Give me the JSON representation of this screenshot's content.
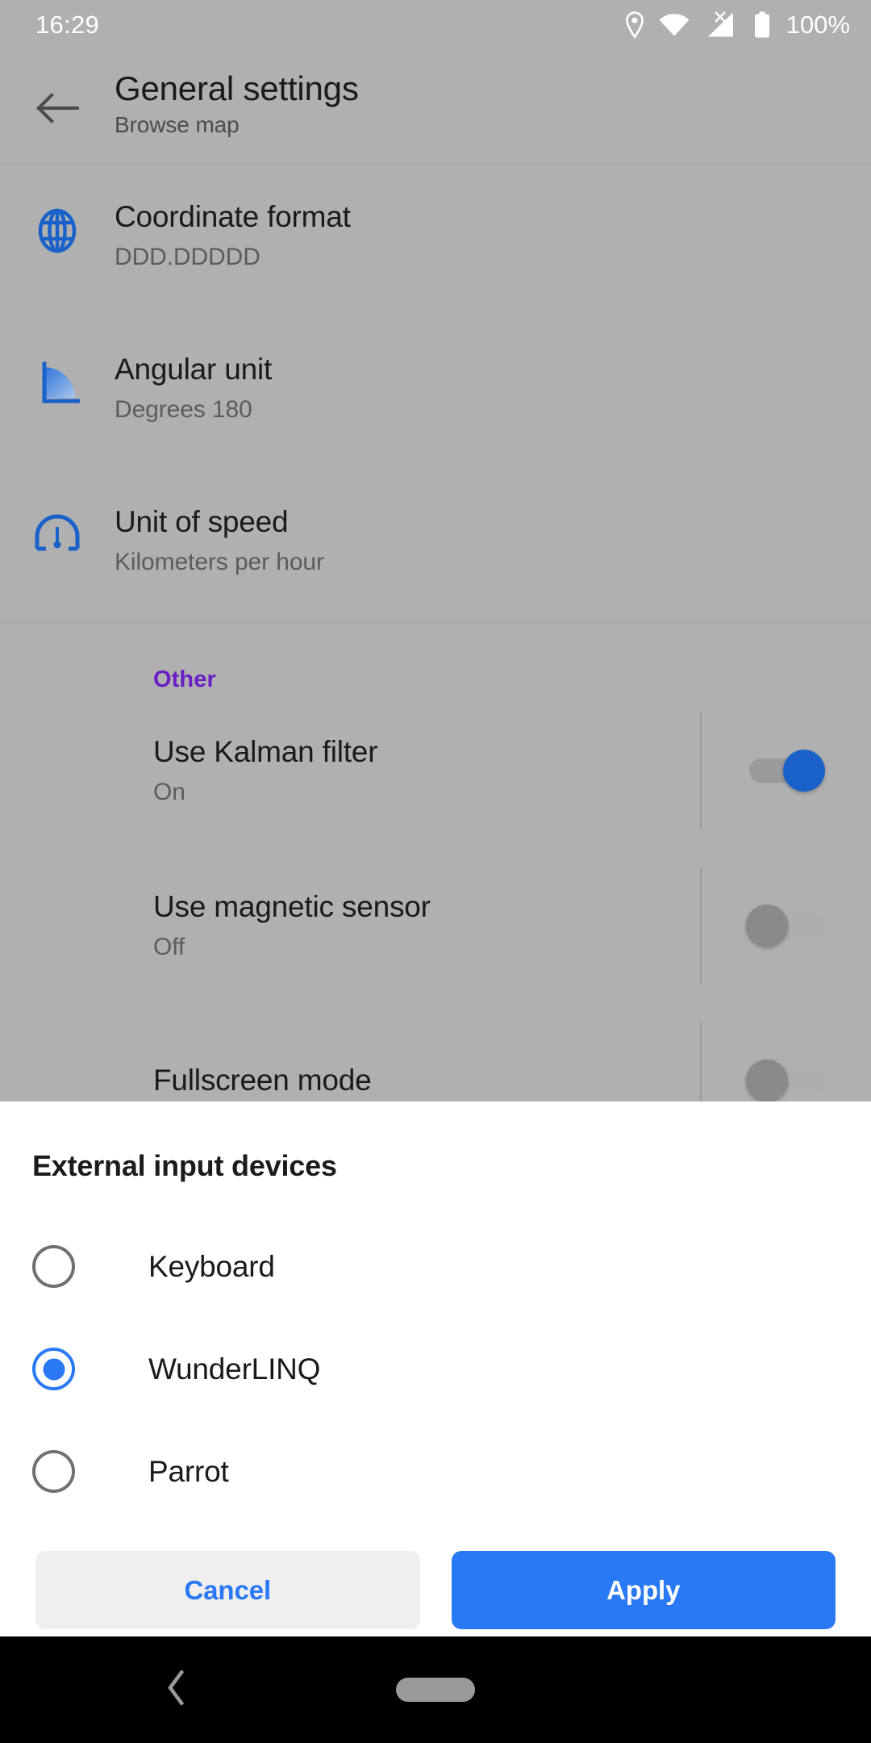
{
  "status_bar": {
    "clock": "16:29",
    "battery_percent": "100%",
    "icons": [
      "location-pin-icon",
      "wifi-icon",
      "cellular-signal-no-service-icon",
      "battery-full-icon"
    ]
  },
  "app_bar": {
    "back_icon": "arrow-back-icon",
    "title": "General settings",
    "subtitle": "Browse map"
  },
  "settings": [
    {
      "icon": "globe-icon",
      "title": "Coordinate format",
      "value": "DDD.DDDDD"
    },
    {
      "icon": "angle-icon",
      "title": "Angular unit",
      "value": "Degrees 180"
    },
    {
      "icon": "speedometer-icon",
      "title": "Unit of speed",
      "value": "Kilometers per hour"
    }
  ],
  "other_section": {
    "header": "Other",
    "rows": [
      {
        "title": "Use Kalman filter",
        "value": "On",
        "toggle": "on"
      },
      {
        "title": "Use magnetic sensor",
        "value": "Off",
        "toggle": "off"
      },
      {
        "title": "Fullscreen mode",
        "value": "",
        "toggle": "off"
      }
    ]
  },
  "dialog": {
    "title": "External input devices",
    "options": [
      {
        "label": "Keyboard",
        "selected": false
      },
      {
        "label": "WunderLINQ",
        "selected": true
      },
      {
        "label": "Parrot",
        "selected": false
      }
    ],
    "cancel_label": "Cancel",
    "apply_label": "Apply"
  },
  "nav_bar": {
    "back_icon": "chevron-back-icon",
    "home_icon": "home-pill-icon"
  },
  "colors": {
    "accent_blue": "#2979f5",
    "toggle_on_blue": "#1a62c9",
    "section_header_purple": "#6a1fc4",
    "scrim_gray": "#b0b0b0",
    "icon_blue": "#1a62c9"
  }
}
